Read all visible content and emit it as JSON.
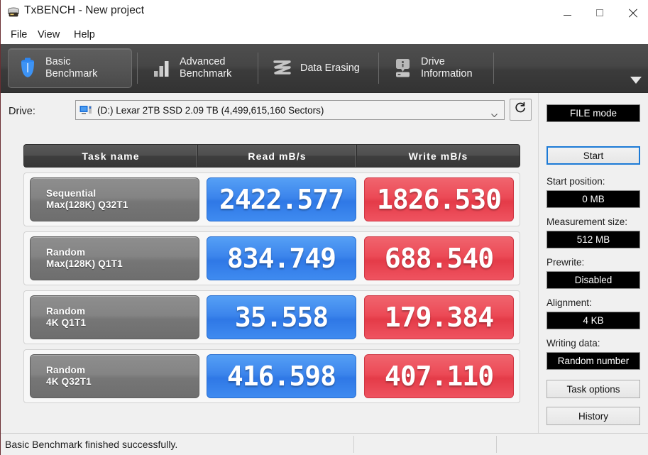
{
  "window": {
    "title": "TxBENCH - New project",
    "icon": "app-disk-icon",
    "minimize_label": "Minimize",
    "maximize_label": "Maximize",
    "close_label": "Close"
  },
  "menu": {
    "items": [
      {
        "label": "File"
      },
      {
        "label": "View"
      },
      {
        "label": "Help"
      }
    ]
  },
  "tabs": {
    "overflow_icon": "chevron-down-icon",
    "items": [
      {
        "label": "Basic\nBenchmark",
        "icon": "stopwatch-icon",
        "active": true
      },
      {
        "label": "Advanced\nBenchmark",
        "icon": "bar-chart-icon",
        "active": false
      },
      {
        "label": "Data Erasing",
        "icon": "scribble-erase-icon",
        "active": false
      },
      {
        "label": "Drive\nInformation",
        "icon": "drive-info-icon",
        "active": false
      }
    ]
  },
  "drive": {
    "label": "Drive:",
    "selected": "(D:) Lexar 2TB SSD  2.09 TB (4,499,615,160 Sectors)",
    "disk_icon": "disk-drive-icon",
    "caret_icon": "chevron-down-icon",
    "refresh_icon": "refresh-icon"
  },
  "results": {
    "columns": [
      "Task name",
      "Read mB/s",
      "Write mB/s"
    ],
    "rows": [
      {
        "name_line1": "Sequential",
        "name_line2": "Max(128K) Q32T1",
        "read": "2422.577",
        "write": "1826.530"
      },
      {
        "name_line1": "Random",
        "name_line2": "Max(128K) Q1T1",
        "read": "834.749",
        "write": "688.540"
      },
      {
        "name_line1": "Random",
        "name_line2": "4K Q1T1",
        "read": "35.558",
        "write": "179.384"
      },
      {
        "name_line1": "Random",
        "name_line2": "4K Q32T1",
        "read": "416.598",
        "write": "407.110"
      }
    ]
  },
  "sidebar": {
    "mode": "FILE mode",
    "start_button": "Start",
    "fields": [
      {
        "label": "Start position:",
        "value": "0 MB"
      },
      {
        "label": "Measurement size:",
        "value": "512 MB"
      },
      {
        "label": "Prewrite:",
        "value": "Disabled"
      },
      {
        "label": "Alignment:",
        "value": "4 KB"
      },
      {
        "label": "Writing data:",
        "value": "Random number"
      }
    ],
    "task_options_button": "Task options",
    "history_button": "History"
  },
  "status": {
    "message": "Basic Benchmark finished successfully."
  },
  "colors": {
    "read_accent": "#3c85ec",
    "write_accent": "#ec4a56",
    "tab_bar": "#464646",
    "header_bar": "#4e4e4e",
    "focus_blue": "#1c7ad6"
  }
}
